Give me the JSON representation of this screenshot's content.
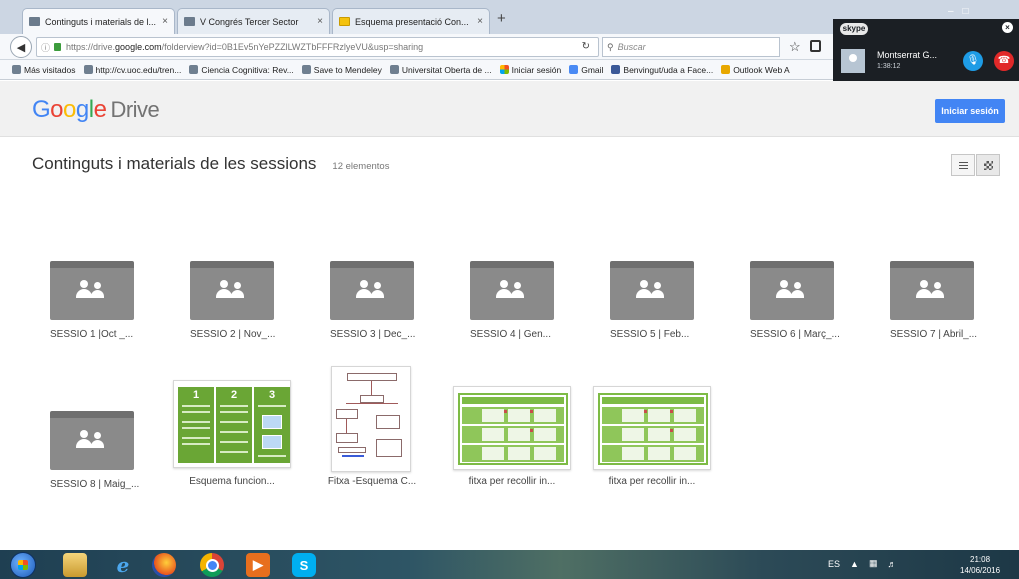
{
  "browser": {
    "tabs": [
      {
        "label": "Continguts i materials de l...",
        "close": "×"
      },
      {
        "label": "V Congrés Tercer Sector",
        "close": "×"
      },
      {
        "label": "Esquema presentació Con...",
        "close": "×"
      }
    ],
    "new_tab": "+",
    "url_prefix": "https://drive.",
    "url_host": "google.com",
    "url_rest": "/folderview?id=0B1Ev5nYePZZlLWZTbFFFRzlyeVU&usp=sharing",
    "search_placeholder": "Buscar",
    "bookmarks": [
      "Más visitados",
      "http://cv.uoc.edu/tren...",
      "Ciencia Cognitiva: Rev...",
      "Save to Mendeley",
      "Universitat Oberta de ...",
      "Iniciar sesión",
      "Gmail",
      "Benvingut/uda a Face...",
      "Outlook Web A"
    ]
  },
  "skype": {
    "logo": "skype",
    "contact": "Montserrat G...",
    "duration": "1:38:12"
  },
  "drive": {
    "logo_letters": [
      "G",
      "o",
      "o",
      "g",
      "l",
      "e"
    ],
    "product": "Drive",
    "signin_label": "Iniciar sesión",
    "folder_title": "Continguts i materials de les sessions",
    "item_count": "12 elementos",
    "folders": [
      "SESSIÓ 1 |Oct _...",
      "SESSIÓ 2 | Nov_...",
      "SESSIÓ 3 | Dec_...",
      "SESSIÓ 4 | Gen...",
      "SESSIÓ 5 | Feb...",
      "SESSIÓ 6 | Març_...",
      "SESSIÓ 7 | Abril_...",
      "SESSIÓ 8 | Maig_..."
    ],
    "files": [
      "Esquema funcion...",
      "Fitxa -Esquema C...",
      "fitxa per recollir in...",
      "fitxa per recollir in..."
    ],
    "esquema_numbers": [
      "1",
      "2",
      "3"
    ]
  },
  "taskbar": {
    "language": "ES",
    "time": "21:08",
    "date": "14/06/2016"
  }
}
